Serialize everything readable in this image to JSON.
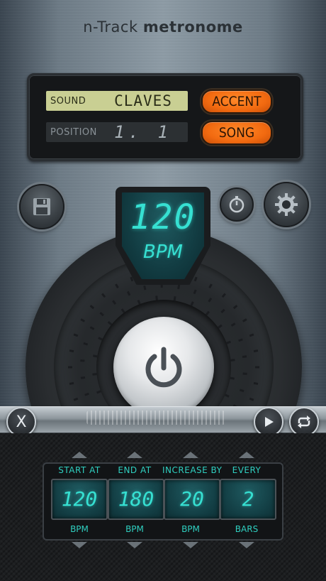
{
  "app": {
    "title_light": "n-Track",
    "title_bold": "metronome"
  },
  "display": {
    "sound_label": "SOUND",
    "sound_value": "CLAVES",
    "position_label": "POSITION",
    "position_value": "1. 1",
    "accent_label": "ACCENT",
    "song_label": "SONG"
  },
  "tempo": {
    "bpm_value": "120",
    "bpm_unit": "BPM"
  },
  "toolbar": {
    "close_label": "X"
  },
  "ramp": {
    "columns": [
      {
        "header": "START AT",
        "value": "120",
        "unit": "BPM"
      },
      {
        "header": "END AT",
        "value": "180",
        "unit": "BPM"
      },
      {
        "header": "INCREASE BY",
        "value": "20",
        "unit": "BPM"
      },
      {
        "header": "EVERY",
        "value": "2",
        "unit": "BARS"
      }
    ]
  },
  "colors": {
    "accent_orange": "#f26a10",
    "lcd_cyan": "#36e0d2",
    "lcd_green": "#c9cf93"
  },
  "icons": [
    "save-icon",
    "timer-icon",
    "gear-icon",
    "power-icon",
    "close-icon",
    "play-icon",
    "loop-icon",
    "arrow-up-icon",
    "arrow-down-icon"
  ]
}
